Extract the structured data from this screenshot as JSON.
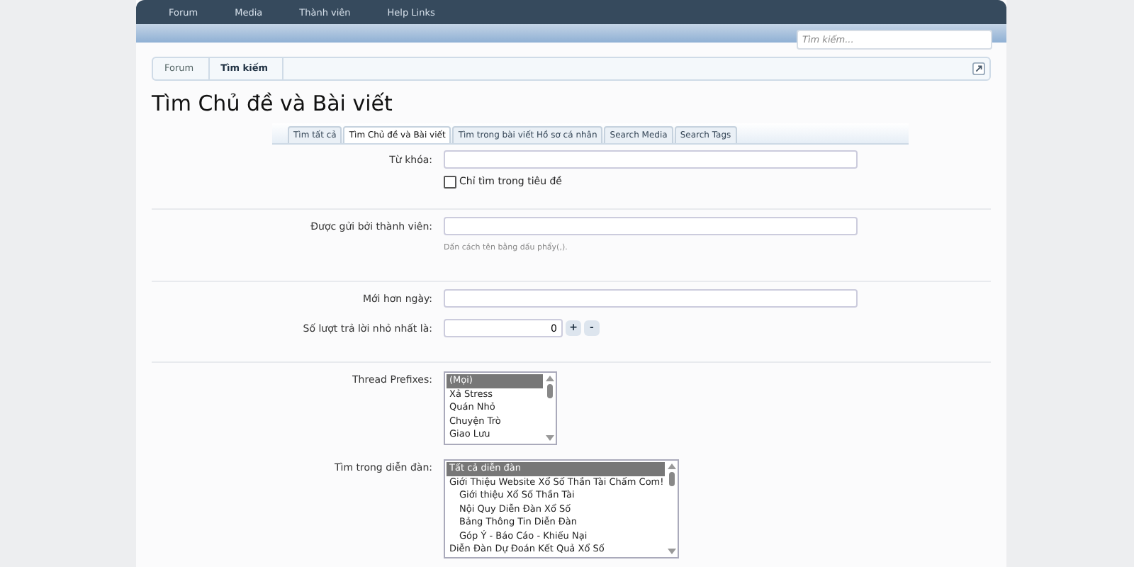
{
  "nav": {
    "items": [
      {
        "label": "Forum"
      },
      {
        "label": "Media"
      },
      {
        "label": "Thành viên"
      },
      {
        "label": "Help Links"
      }
    ]
  },
  "search": {
    "placeholder": "Tìm kiếm..."
  },
  "breadcrumb": {
    "items": [
      {
        "label": "Forum",
        "current": false
      },
      {
        "label": "Tìm kiếm",
        "current": true
      }
    ]
  },
  "title": "Tìm Chủ đề và Bài viết",
  "tabs": [
    {
      "label": "Tìm tất cả",
      "selected": false
    },
    {
      "label": "Tìm Chủ đề và Bài viết",
      "selected": true
    },
    {
      "label": "Tìm trong bài viết Hồ sơ cá nhân",
      "selected": false
    },
    {
      "label": "Search Media",
      "selected": false
    },
    {
      "label": "Search Tags",
      "selected": false
    }
  ],
  "form": {
    "keywords": {
      "label": "Từ khóa:"
    },
    "title_only": {
      "label": "Chỉ tìm trong tiêu đề",
      "checked": false
    },
    "member": {
      "label": "Được gửi bởi thành viên:",
      "hint": "Dấn cách tên bằng dấu phẩy(,)."
    },
    "newer_than": {
      "label": "Mới hơn ngày:"
    },
    "min_replies": {
      "label": "Số lượt trả lời nhỏ nhất là:",
      "value": "0",
      "plus": "+",
      "minus": "-"
    },
    "prefixes": {
      "label": "Thread Prefixes:",
      "options": [
        {
          "label": "(Mọi)",
          "selected": true
        },
        {
          "label": "Xả Stress",
          "selected": false
        },
        {
          "label": "Quán Nhỏ",
          "selected": false
        },
        {
          "label": "Chuyện Trò",
          "selected": false
        },
        {
          "label": "Giao Lưu",
          "selected": false
        }
      ]
    },
    "forums": {
      "label": "Tìm trong diễn đàn:",
      "options": [
        {
          "label": "Tất cả diễn đàn",
          "selected": true
        },
        {
          "label": "Giới Thiệu Website Xổ Số Thần Tài Chấm Com!",
          "selected": false,
          "children": [
            {
              "label": "Giới thiệu Xổ Số Thần Tài",
              "selected": false
            },
            {
              "label": "Nội Quy Diễn Đàn Xổ Số",
              "selected": false
            },
            {
              "label": "Bảng Thông Tin Diễn Đàn",
              "selected": false
            },
            {
              "label": "Góp Ý - Báo Cáo - Khiếu Nại",
              "selected": false
            }
          ]
        },
        {
          "label": "Diễn Đàn Dự Đoán Kết Quả Xổ Số",
          "selected": false
        }
      ]
    }
  }
}
